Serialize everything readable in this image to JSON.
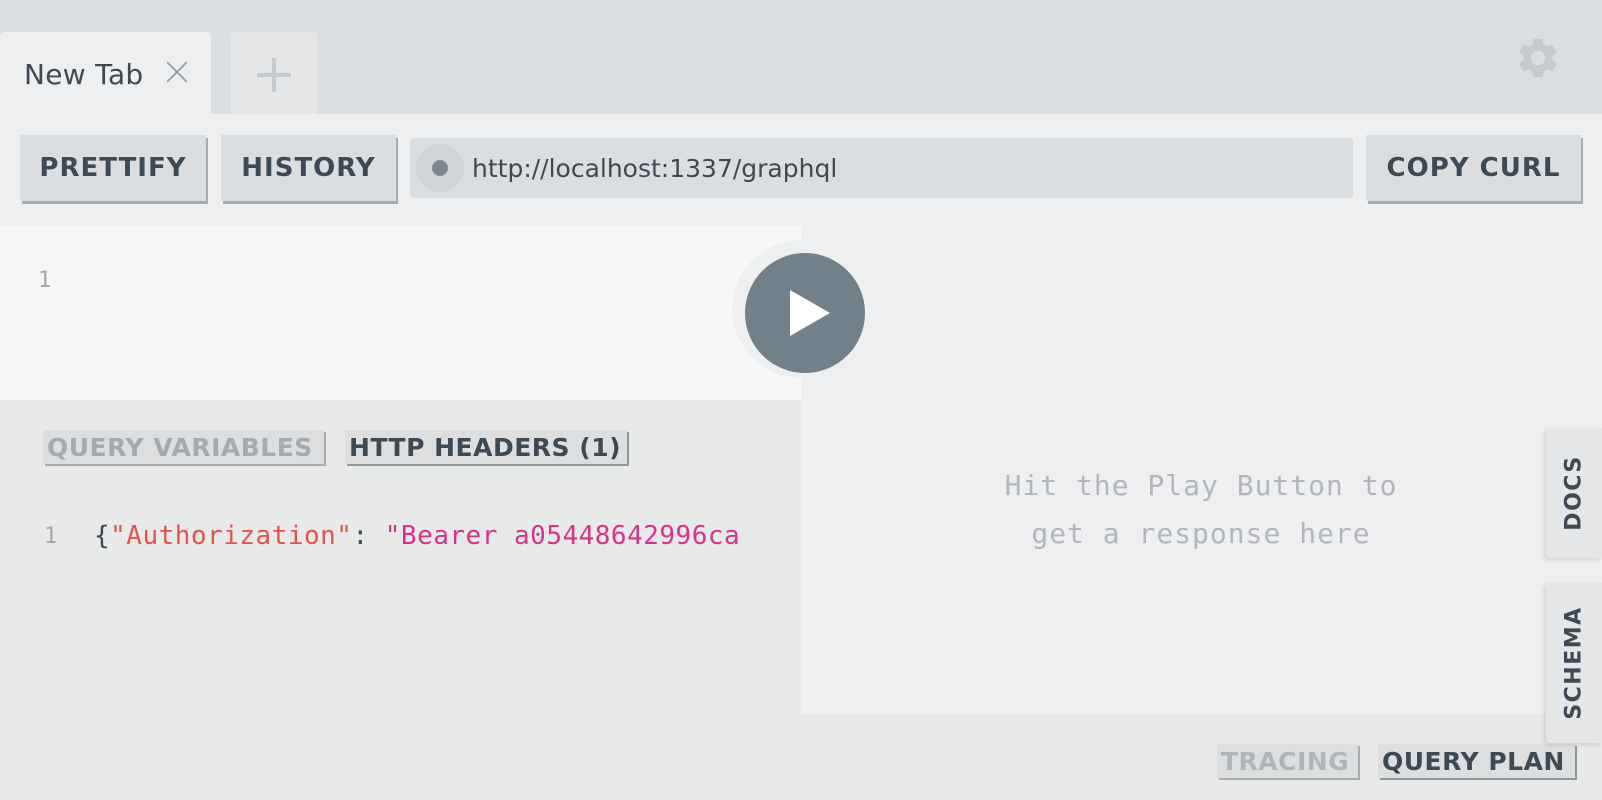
{
  "tabs": [
    {
      "title": "New Tab"
    }
  ],
  "toolbar": {
    "prettify_label": "PRETTIFY",
    "history_label": "HISTORY",
    "url": "http://localhost:1337/graphql",
    "copy_curl_label": "COPY CURL"
  },
  "query_editor": {
    "line_number": "1"
  },
  "variables_panel": {
    "query_variables_label": "QUERY VARIABLES",
    "http_headers_label": "HTTP HEADERS (1)",
    "line_number": "1",
    "code": {
      "open_brace": "{",
      "key": "\"Authorization\"",
      "colon": ": ",
      "value": "\"Bearer a05448642996ca"
    }
  },
  "result_panel": {
    "hint_line1": "Hit the Play Button to",
    "hint_line2": "get a response here",
    "tracing_label": "TRACING",
    "query_plan_label": "QUERY PLAN"
  },
  "side_tabs": {
    "docs_label": "DOCS",
    "schema_label": "SCHEMA"
  },
  "icons": {
    "tab_close": "close-icon",
    "tab_add": "plus-icon",
    "settings": "gear-icon",
    "run": "play-icon",
    "url_status": "status-dot-icon"
  },
  "colors": {
    "play_button": "#72808a",
    "json_key": "#e5534b",
    "json_string": "#d6338c",
    "text_primary": "#3d4a56"
  }
}
